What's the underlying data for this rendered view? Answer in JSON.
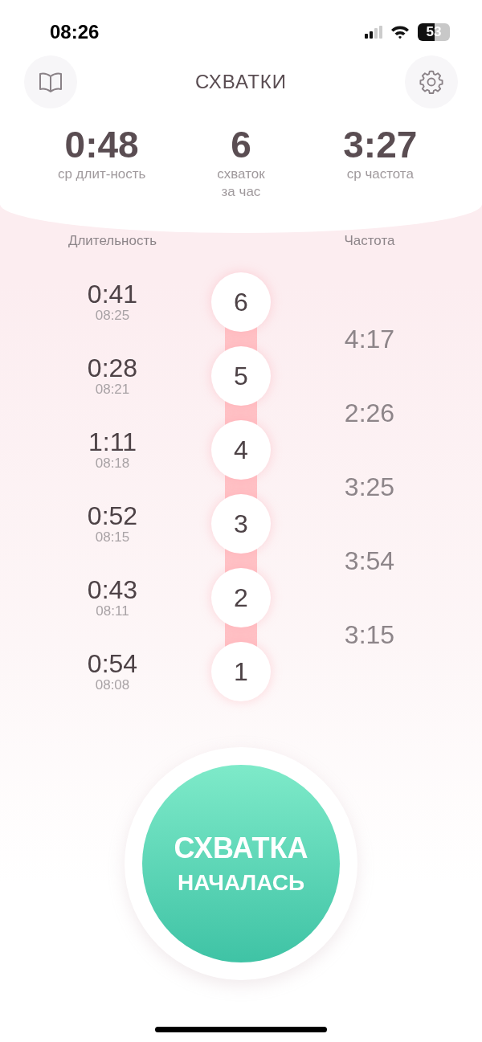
{
  "status_bar": {
    "time": "08:26",
    "battery": "53"
  },
  "header": {
    "title": "СХВАТКИ"
  },
  "stats": [
    {
      "value": "0:48",
      "label": "ср длит-ность"
    },
    {
      "value": "6",
      "label": "схваток\nза час"
    },
    {
      "value": "3:27",
      "label": "ср частота"
    }
  ],
  "columns": {
    "duration": "Длительность",
    "frequency": "Частота"
  },
  "contractions": [
    {
      "number": "6",
      "duration": "0:41",
      "time": "08:25"
    },
    {
      "number": "5",
      "duration": "0:28",
      "time": "08:21"
    },
    {
      "number": "4",
      "duration": "1:11",
      "time": "08:18"
    },
    {
      "number": "3",
      "duration": "0:52",
      "time": "08:15"
    },
    {
      "number": "2",
      "duration": "0:43",
      "time": "08:11"
    },
    {
      "number": "1",
      "duration": "0:54",
      "time": "08:08"
    }
  ],
  "frequencies": [
    "4:17",
    "2:26",
    "3:25",
    "3:54",
    "3:15"
  ],
  "start_button": {
    "label_line1": "СХВАТКА",
    "label_line2": "НАЧАЛАСЬ"
  }
}
